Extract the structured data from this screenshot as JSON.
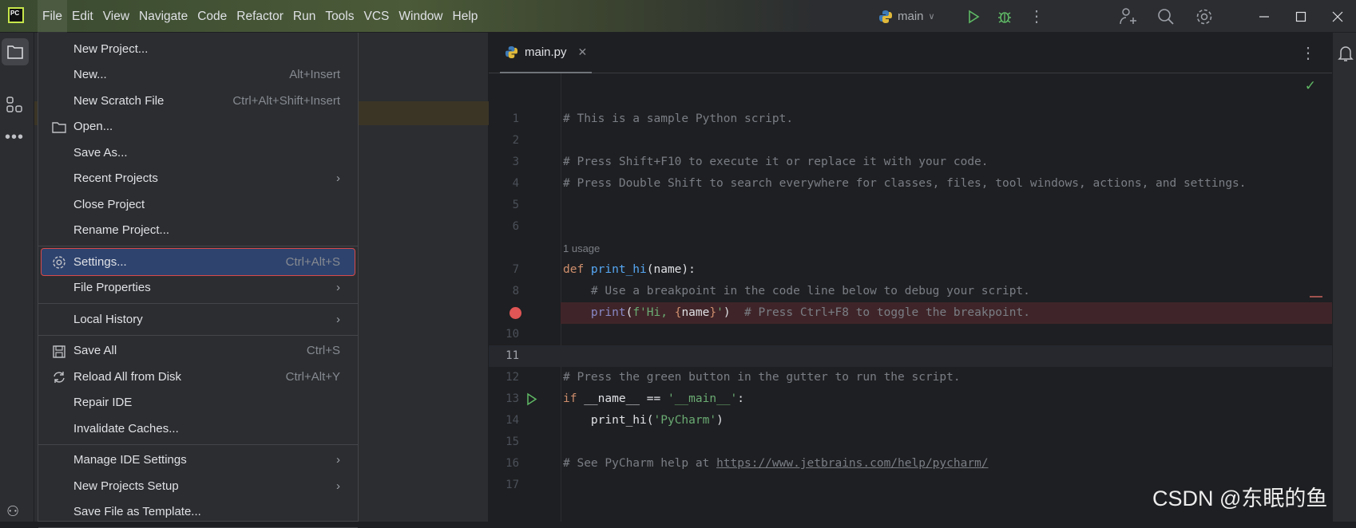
{
  "titlebar": {
    "menus": [
      "File",
      "Edit",
      "View",
      "Navigate",
      "Code",
      "Refactor",
      "Run",
      "Tools",
      "VCS",
      "Window",
      "Help"
    ],
    "run_config": "main"
  },
  "file_menu": {
    "items": [
      {
        "label": "New Project...",
        "shortcut": "",
        "submenu": false,
        "icon": ""
      },
      {
        "label": "New...",
        "shortcut": "Alt+Insert",
        "submenu": false,
        "icon": ""
      },
      {
        "label": "New Scratch File",
        "shortcut": "Ctrl+Alt+Shift+Insert",
        "submenu": false,
        "icon": ""
      },
      {
        "label": "Open...",
        "shortcut": "",
        "submenu": false,
        "icon": "folder-icon"
      },
      {
        "label": "Save As...",
        "shortcut": "",
        "submenu": false,
        "icon": ""
      },
      {
        "label": "Recent Projects",
        "shortcut": "",
        "submenu": true,
        "icon": ""
      },
      {
        "label": "Close Project",
        "shortcut": "",
        "submenu": false,
        "icon": ""
      },
      {
        "label": "Rename Project...",
        "shortcut": "",
        "submenu": false,
        "icon": ""
      },
      {
        "sep": true
      },
      {
        "label": "Settings...",
        "shortcut": "Ctrl+Alt+S",
        "submenu": false,
        "icon": "gear-icon",
        "selected": true
      },
      {
        "label": "File Properties",
        "shortcut": "",
        "submenu": true,
        "icon": ""
      },
      {
        "sep": true
      },
      {
        "label": "Local History",
        "shortcut": "",
        "submenu": true,
        "icon": ""
      },
      {
        "sep": true
      },
      {
        "label": "Save All",
        "shortcut": "Ctrl+S",
        "submenu": false,
        "icon": "save-icon"
      },
      {
        "label": "Reload All from Disk",
        "shortcut": "Ctrl+Alt+Y",
        "submenu": false,
        "icon": "reload-icon"
      },
      {
        "label": "Repair IDE",
        "shortcut": "",
        "submenu": false,
        "icon": ""
      },
      {
        "label": "Invalidate Caches...",
        "shortcut": "",
        "submenu": false,
        "icon": ""
      },
      {
        "sep": true
      },
      {
        "label": "Manage IDE Settings",
        "shortcut": "",
        "submenu": true,
        "icon": ""
      },
      {
        "label": "New Projects Setup",
        "shortcut": "",
        "submenu": true,
        "icon": ""
      },
      {
        "label": "Save File as Template...",
        "shortcut": "",
        "submenu": false,
        "icon": ""
      },
      {
        "sep": true
      }
    ]
  },
  "editor": {
    "tab": "main.py",
    "usage_hint": "1 usage",
    "lines": [
      {
        "n": "1",
        "parts": [
          [
            "c",
            "# This is a sample Python script."
          ]
        ]
      },
      {
        "n": "2",
        "parts": []
      },
      {
        "n": "3",
        "parts": [
          [
            "c",
            "# Press Shift+F10 to execute it or replace it with your code."
          ]
        ]
      },
      {
        "n": "4",
        "parts": [
          [
            "c",
            "# Press Double Shift to search everywhere for classes, files, tool windows, actions, and settings."
          ]
        ]
      },
      {
        "n": "5",
        "parts": []
      },
      {
        "n": "6",
        "parts": []
      },
      {
        "n": "",
        "usage": true,
        "parts": []
      },
      {
        "n": "7",
        "parts": [
          [
            "k",
            "def "
          ],
          [
            "f",
            "print_hi"
          ],
          [
            "",
            "(name):"
          ]
        ]
      },
      {
        "n": "8",
        "parts": [
          [
            "",
            "    "
          ],
          [
            "c",
            "# Use a breakpoint in the code line below to debug your script."
          ]
        ]
      },
      {
        "n": "9",
        "breakpoint": true,
        "parts": [
          [
            "",
            "    "
          ],
          [
            "b",
            "print"
          ],
          [
            "",
            "("
          ],
          [
            "s",
            "f'Hi, "
          ],
          [
            "k",
            "{"
          ],
          [
            "",
            "name"
          ],
          [
            "k",
            "}"
          ],
          [
            "s",
            "'"
          ],
          [
            "",
            ")  "
          ],
          [
            "c",
            "# Press Ctrl+F8 to toggle the breakpoint."
          ]
        ]
      },
      {
        "n": "10",
        "parts": []
      },
      {
        "n": "11",
        "current": true,
        "parts": []
      },
      {
        "n": "12",
        "parts": [
          [
            "c",
            "# Press the green button in the gutter to run the script."
          ]
        ]
      },
      {
        "n": "13",
        "run": true,
        "parts": [
          [
            "k",
            "if "
          ],
          [
            "",
            "__name__ == "
          ],
          [
            "s",
            "'__main__'"
          ],
          [
            "",
            ":"
          ]
        ]
      },
      {
        "n": "14",
        "parts": [
          [
            "",
            "    print_hi("
          ],
          [
            "s",
            "'PyCharm'"
          ],
          [
            "",
            ")"
          ]
        ]
      },
      {
        "n": "15",
        "parts": []
      },
      {
        "n": "16",
        "parts": [
          [
            "c",
            "# See PyCharm help at "
          ],
          [
            "u",
            "https://www.jetbrains.com/help/pycharm/"
          ]
        ]
      },
      {
        "n": "17",
        "parts": []
      }
    ]
  },
  "watermark": "CSDN @东眠的鱼",
  "colors": {
    "accent_selection": "#2e436e",
    "highlight_border": "#d94a4a",
    "breakpoint": "#e05555",
    "run": "#5fb865"
  }
}
